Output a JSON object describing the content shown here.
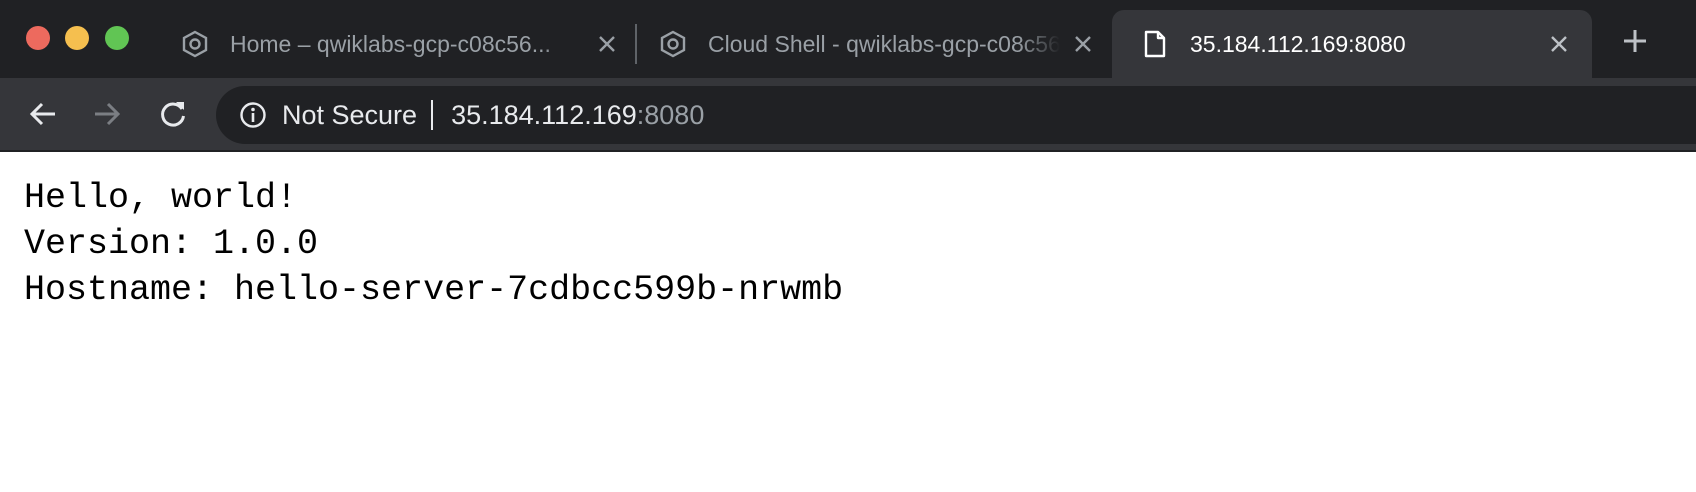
{
  "tabs": [
    {
      "title": "Home – qwiklabs-gcp-c08c56...",
      "icon": "gcp-hexagon-icon",
      "active": false
    },
    {
      "title": "Cloud Shell - qwiklabs-gcp-c08c56...",
      "icon": "gcp-hexagon-icon",
      "active": false
    },
    {
      "title": "35.184.112.169:8080",
      "icon": "page-icon",
      "active": true
    }
  ],
  "address_bar": {
    "security_label": "Not Secure",
    "host": "35.184.112.169",
    "port": ":8080"
  },
  "page": {
    "lines": [
      "Hello, world!",
      "Version: 1.0.0",
      "Hostname: hello-server-7cdbcc599b-nrwmb"
    ]
  },
  "colors": {
    "tabstrip_bg": "#202124",
    "active_tab_bg": "#35363a",
    "traffic_close": "#ed6a5e",
    "traffic_min": "#f5bf4f",
    "traffic_max": "#61c554"
  }
}
